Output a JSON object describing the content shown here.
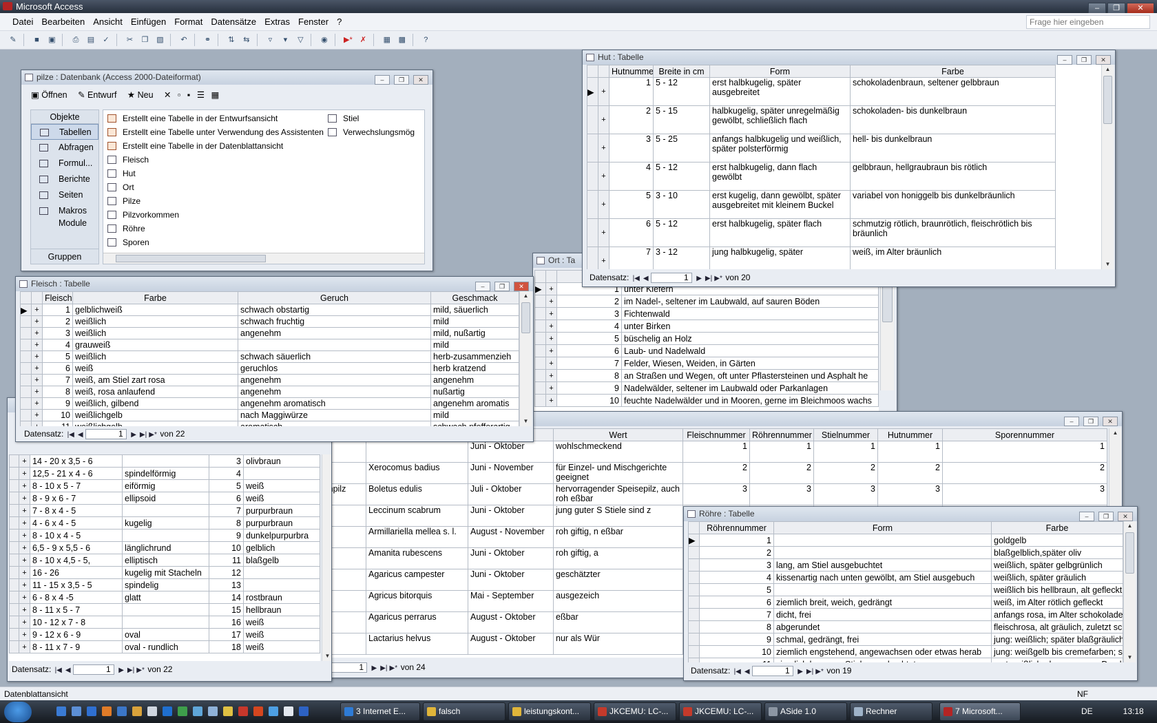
{
  "app": {
    "title": "Microsoft Access",
    "help_placeholder": "Frage hier eingeben",
    "status_left": "Datenblattansicht",
    "status_right": "NF"
  },
  "menu": [
    "Datei",
    "Bearbeiten",
    "Ansicht",
    "Einfügen",
    "Format",
    "Datensätze",
    "Extras",
    "Fenster",
    "?"
  ],
  "db": {
    "title": "pilze : Datenbank (Access 2000-Dateiformat)",
    "open": "Öffnen",
    "design": "Entwurf",
    "new": "Neu",
    "objects_label": "Objekte",
    "groups_label": "Gruppen",
    "sidebar": [
      "Tabellen",
      "Abfragen",
      "Formul...",
      "Berichte",
      "Seiten",
      "Makros",
      "Module"
    ],
    "list_col1": [
      "Erstellt eine Tabelle in der Entwurfsansicht",
      "Erstellt eine Tabelle unter Verwendung des Assistenten",
      "Erstellt eine Tabelle in der Datenblattansicht",
      "Fleisch",
      "Hut",
      "Ort",
      "Pilze",
      "Pilzvorkommen",
      "Röhre",
      "Sporen"
    ],
    "list_col2": [
      "Stiel",
      "Verwechslungsmög"
    ]
  },
  "hut": {
    "title": "Hut : Tabelle",
    "headers": [
      "Hutnumme",
      "Breite in cm",
      "Form",
      "Farbe"
    ],
    "rows": [
      [
        "1",
        "5 - 12",
        "erst halbkugelig, später ausgebreitet",
        "schokoladenbraun, seltener gelbbraun"
      ],
      [
        "2",
        "5 - 15",
        "halbkugelig, später unregelmäßig gewölbt, schließlich flach",
        "schokoladen- bis dunkelbraun"
      ],
      [
        "3",
        "5 - 25",
        "anfangs halbkugelig und weißlich, später polsterförmig",
        "hell- bis dunkelbraun"
      ],
      [
        "4",
        "5 - 12",
        "erst halbkugelig, dann flach gewölbt",
        "gelbbraun, hellgraubraun bis rötlich"
      ],
      [
        "5",
        "3 - 10",
        "erst kugelig, dann gewölbt, später ausgebreitet mit kleinem Buckel",
        "variabel von honiggelb bis dunkelbräunlich"
      ],
      [
        "6",
        "5 - 12",
        "erst halbkugelig, später flach",
        "schmutzig rötlich, braunrötlich, fleischrötlich bis bräunlich"
      ],
      [
        "7",
        "3 - 12",
        "jung halbkugelig, später",
        "weiß, im Alter bräunlich"
      ]
    ],
    "nav_label": "Datensatz:",
    "nav_rec": "1",
    "nav_total": "von 20"
  },
  "ort": {
    "title": "Ort : Ta",
    "header": "Ort",
    "rows": [
      [
        "1",
        "unter Kiefern"
      ],
      [
        "2",
        "im Nadel-, seltener im Laubwald, auf sauren Böden"
      ],
      [
        "3",
        "Fichtenwald"
      ],
      [
        "4",
        "unter Birken"
      ],
      [
        "5",
        "büschelig an Holz"
      ],
      [
        "6",
        "Laub- und Nadelwald"
      ],
      [
        "7",
        "Felder, Wiesen, Weiden, in Gärten"
      ],
      [
        "8",
        "an Straßen und Wegen, oft unter Pflastersteinen und Asphalt he"
      ],
      [
        "9",
        "Nadelwälder, seltener im Laubwald oder Parkanlagen"
      ],
      [
        "10",
        "feuchte Nadelwälder und in Mooren, gerne im Bleichmoos wachs"
      ]
    ]
  },
  "fleisch": {
    "title": "Fleisch : Tabelle",
    "headers": [
      "Fleisch",
      "Farbe",
      "Geruch",
      "Geschmack"
    ],
    "rows": [
      [
        "1",
        "gelblichweiß",
        "schwach obstartig",
        "mild, säuerlich"
      ],
      [
        "2",
        "weißlich",
        "schwach fruchtig",
        "mild"
      ],
      [
        "3",
        "weißlich",
        "angenehm",
        "mild, nußartig"
      ],
      [
        "4",
        "grauweiß",
        "",
        "mild"
      ],
      [
        "5",
        "weißlich",
        "schwach säuerlich",
        "herb-zusammenzieh"
      ],
      [
        "6",
        "weiß",
        "geruchlos",
        "herb kratzend"
      ],
      [
        "7",
        "weiß, am Stiel zart rosa",
        "angenehm",
        "angenehm"
      ],
      [
        "8",
        "weiß, rosa anlaufend",
        "angenehm",
        "nußartig"
      ],
      [
        "9",
        "weißlich, gilbend",
        "angenehm aromatisch",
        "angenehm aromatis"
      ],
      [
        "10",
        "weißlichgelb",
        "nach Maggiwürze",
        "mild"
      ],
      [
        "11",
        "weißlichgelb",
        "aromatisch",
        "schwach pfefferartig"
      ]
    ],
    "nav_label": "Datensatz:",
    "nav_rec": "1",
    "nav_total": "von 22"
  },
  "sporen": {
    "rows": [
      [
        "14 - 20 x 3,5 - 6",
        "",
        "3",
        "olivbraun"
      ],
      [
        "12,5 - 21 x 4 - 6",
        "spindelförmig",
        "4",
        ""
      ],
      [
        "8 - 10 x 5 - 7",
        "eiförmig",
        "5",
        "weiß"
      ],
      [
        "8 - 9 x 6 - 7",
        "ellipsoid",
        "6",
        "weiß"
      ],
      [
        "7 - 8 x 4 - 5",
        "",
        "7",
        "purpurbraun"
      ],
      [
        "4 - 6 x 4 - 5",
        "kugelig",
        "8",
        "purpurbraun"
      ],
      [
        "8 - 10 x 4 - 5",
        "",
        "9",
        "dunkelpurpurbra"
      ],
      [
        "6,5 - 9 x 5,5 - 6",
        "länglichrund",
        "10",
        "gelblich"
      ],
      [
        "8 - 10 x 4,5 - 5,",
        "elliptisch",
        "11",
        "blaßgelb"
      ],
      [
        "16 - 26",
        "kugelig mit Stacheln",
        "12",
        ""
      ],
      [
        "11 - 15 x 3,5 - 5",
        "spindelig",
        "13",
        ""
      ],
      [
        "6 - 8 x 4 -5",
        "glatt",
        "14",
        "rostbraun"
      ],
      [
        "8 - 11 x 5 - 7",
        "",
        "15",
        "hellbraun"
      ],
      [
        "10 - 12 x 7 - 8",
        "",
        "16",
        "weiß"
      ],
      [
        "9 - 12 x 6 - 9",
        "oval",
        "17",
        "weiß"
      ],
      [
        "8 - 11 x 7 - 9",
        "oval - rundlich",
        "18",
        "weiß"
      ]
    ],
    "nav_label": "Datensatz:",
    "nav_rec": "1",
    "nav_total": "von 22"
  },
  "pilze": {
    "headers": [
      "Zeit",
      "Wert",
      "Fleischnummer",
      "Röhrennummer",
      "Stielnummer",
      "Hutnummer",
      "Sporennummer"
    ],
    "rows": [
      [
        "",
        "",
        "Juni - Oktober",
        "wohlschmeckend",
        "1",
        "1",
        "1",
        "1",
        "1"
      ],
      [
        "ronenröhrling",
        "Xerocomus badius",
        "Juni - November",
        "für Einzel- und Mischgerichte geeignet",
        "2",
        "2",
        "2",
        "2",
        "2"
      ],
      [
        "npilz,Fichtensteinpilz",
        "Boletus edulis",
        "Juli - Oktober",
        "hervorragender Speisepilz, auch roh eßbar",
        "3",
        "3",
        "3",
        "3",
        "3"
      ],
      [
        "kenpilz",
        "Leccinum scabrum",
        "Juni - Oktober",
        "jung guter S Stiele sind z",
        "",
        "",
        "",
        "",
        ""
      ],
      [
        "imasch",
        "Armillariella mellea s. l.",
        "August - November",
        "roh giftig, n eßbar",
        "",
        "",
        "",
        "",
        ""
      ],
      [
        "lpilz",
        "Amanita rubescens",
        "Juni - Oktober",
        "roh giftig, a",
        "",
        "",
        "",
        "",
        ""
      ],
      [
        "esenchampignon",
        "Agaricus campester",
        "Juni - Oktober",
        "geschätzter",
        "",
        "",
        "",
        "",
        ""
      ],
      [
        "dt-Champignon",
        "Agricus bitorquis",
        "Mai - September",
        "ausgezeich",
        "",
        "",
        "",
        "",
        ""
      ],
      [
        "senchampignon",
        "Agaricus perrarus",
        "August - Oktober",
        "eßbar",
        "",
        "",
        "",
        "",
        ""
      ],
      [
        "ggipilz",
        "Lactarius helvus",
        "August - Oktober",
        "nur als Wür",
        "",
        "",
        "",
        "",
        ""
      ]
    ],
    "nav_rec": "1",
    "nav_total": "von 24"
  },
  "roehre": {
    "title": "Röhre : Tabelle",
    "headers": [
      "Röhrennummer",
      "Form",
      "Farbe"
    ],
    "rows": [
      [
        "1",
        "",
        "goldgelb"
      ],
      [
        "2",
        "",
        "blaßgelblich,später oliv"
      ],
      [
        "3",
        "lang, am Stiel ausgebuchtet",
        "weißlich, später gelbgrünlich"
      ],
      [
        "4",
        "kissenartig nach unten gewölbt, am Stiel ausgebuch",
        "weißlich, später gräulich"
      ],
      [
        "5",
        "",
        "weißlich bis hellbraun, alt gefleckt"
      ],
      [
        "6",
        "ziemlich breit, weich, gedrängt",
        "weiß, im Alter rötlich gefleckt"
      ],
      [
        "7",
        "dicht, frei",
        "anfangs rosa, im Alter schokoladen"
      ],
      [
        "8",
        "abgerundet",
        "fleischrosa, alt gräulich, zuletzt sch"
      ],
      [
        "9",
        "schmal, gedrängt, frei",
        "jung: weißlich; später blaßgräulich;"
      ],
      [
        "10",
        "ziemlich engstehend, angewachsen oder etwas herab",
        "jung: weißgelb bis cremefarben; spä"
      ],
      [
        "11",
        "ziemlich lang, am Stiel ausgebuchtet",
        "erst weißlich, dann rosa, an Drucks"
      ]
    ],
    "nav_label": "Datensatz:",
    "nav_rec": "1",
    "nav_total": "von 19"
  },
  "taskbar": {
    "tasks": [
      "3 Internet E...",
      "falsch",
      "leistungskont...",
      "JKCEMU: LC-...",
      "JKCEMU: LC-...",
      "ASide 1.0",
      "Rechner",
      "7 Microsoft..."
    ],
    "lang": "DE",
    "clock": "13:18"
  }
}
